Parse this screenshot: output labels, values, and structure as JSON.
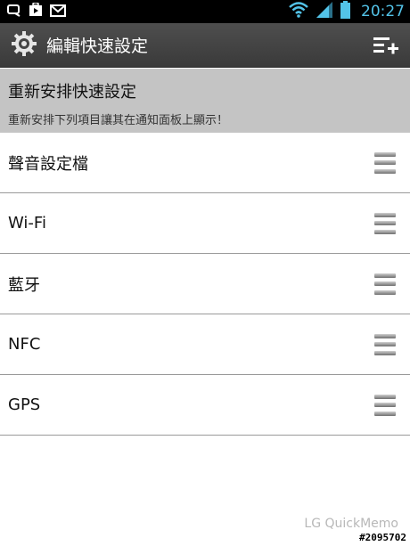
{
  "status_bar": {
    "time": "20:27",
    "icons": [
      "quickmemo-icon",
      "play-store-icon",
      "gmail-icon",
      "wifi-icon",
      "signal-icon",
      "battery-icon"
    ]
  },
  "action_bar": {
    "title": "編輯快速設定",
    "left_icon": "gear-icon",
    "right_icon": "add-list-icon"
  },
  "section": {
    "title": "重新安排快速設定",
    "subtitle": "重新安排下列項目讓其在通知面板上顯示！"
  },
  "items": [
    {
      "label": "聲音設定檔"
    },
    {
      "label": "Wi-Fi"
    },
    {
      "label": "藍牙"
    },
    {
      "label": "NFC"
    },
    {
      "label": "GPS"
    }
  ],
  "watermark": {
    "text": "LG QuickMemo",
    "id": "#2095702"
  },
  "colors": {
    "status_time": "#53c3e8",
    "action_bar": "#444444",
    "section_bg": "#c4c4c4"
  }
}
